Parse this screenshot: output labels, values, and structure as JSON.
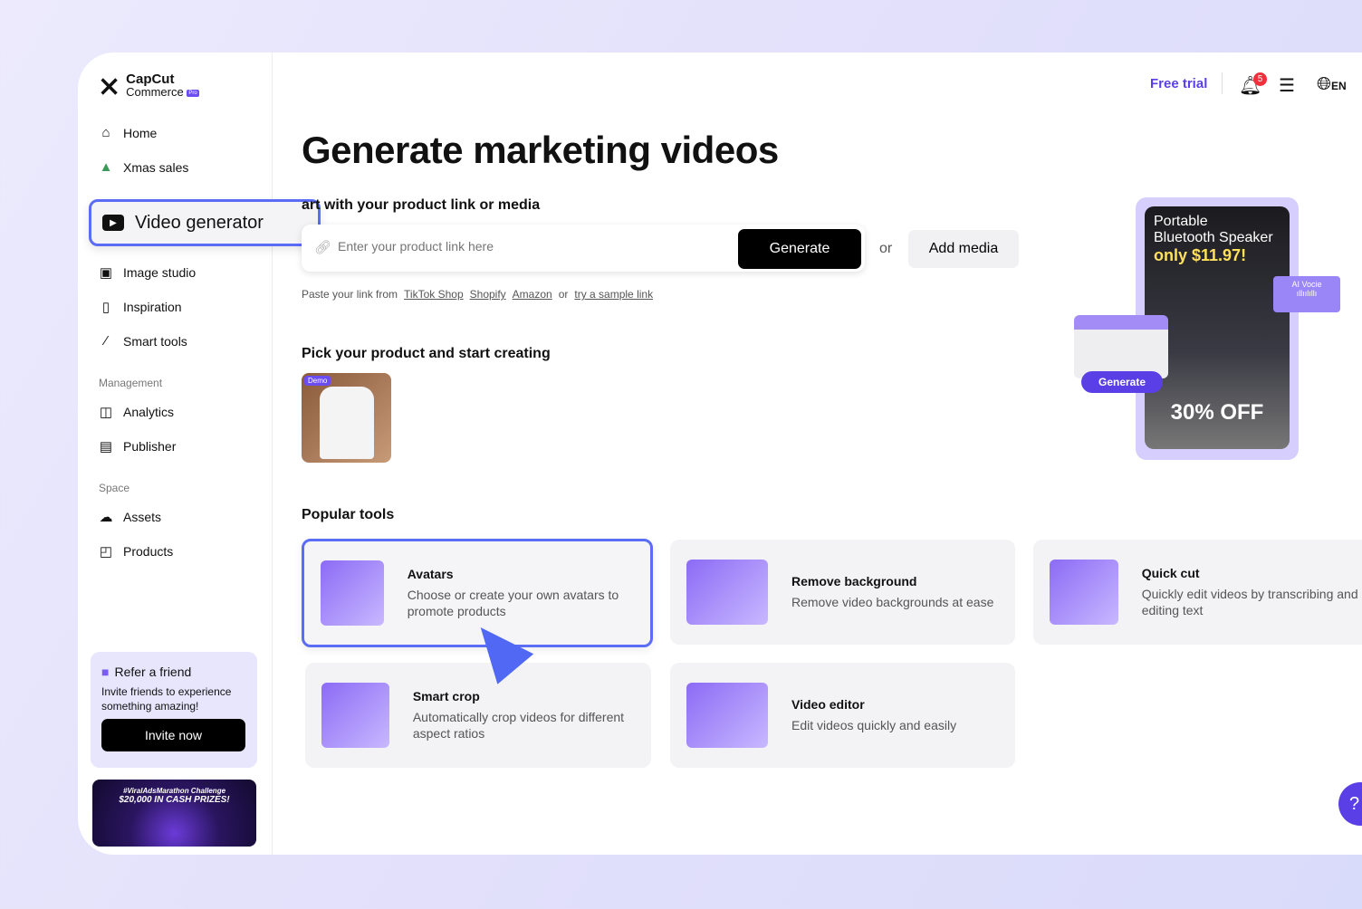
{
  "brand": {
    "name": "CapCut",
    "sub": "Commerce",
    "badge": "Pro"
  },
  "sidebar": {
    "items": [
      {
        "label": "Home",
        "icon": "home-icon"
      },
      {
        "label": "Xmas sales",
        "icon": "tree-icon"
      },
      {
        "label": "Video generator",
        "icon": "video-sparkle-icon"
      },
      {
        "label": "Image studio",
        "icon": "image-icon"
      },
      {
        "label": "Inspiration",
        "icon": "inspiration-icon"
      },
      {
        "label": "Smart tools",
        "icon": "magic-wand-icon"
      }
    ],
    "management_label": "Management",
    "management": [
      {
        "label": "Analytics",
        "icon": "chart-icon"
      },
      {
        "label": "Publisher",
        "icon": "calendar-icon"
      }
    ],
    "space_label": "Space",
    "space": [
      {
        "label": "Assets",
        "icon": "cloud-icon"
      },
      {
        "label": "Products",
        "icon": "bag-icon"
      }
    ],
    "refer": {
      "title": "Refer a friend",
      "text": "Invite friends to experience something amazing!",
      "button": "Invite now"
    },
    "banner": {
      "line1": "#ViralAdsMarathon Challenge",
      "line2": "$20,000 IN CASH PRIZES!"
    }
  },
  "header": {
    "free_trial": "Free trial",
    "notifications": "5",
    "language": "EN"
  },
  "main": {
    "title": "Generate marketing videos",
    "start_label": "art with your product link or media",
    "input_placeholder": "Enter your product link here",
    "generate": "Generate",
    "or": "or",
    "add_media": "Add media",
    "paste": {
      "prefix": "Paste your link from",
      "tiktok": "TikTok Shop",
      "shopify": "Shopify",
      "amazon": "Amazon",
      "or": "or",
      "sample": "try a sample link"
    },
    "pick_label": "Pick your product and start creating",
    "demo_badge": "Demo",
    "popular_label": "Popular tools",
    "tools": [
      {
        "title": "Avatars",
        "desc": "Choose or create your own avatars to promote products"
      },
      {
        "title": "Remove background",
        "desc": "Remove video backgrounds at ease"
      },
      {
        "title": "Quick cut",
        "desc": "Quickly edit videos by transcribing and editing text"
      },
      {
        "title": "Smart crop",
        "desc": "Automatically crop videos for different aspect ratios"
      },
      {
        "title": "Video editor",
        "desc": "Edit videos quickly and easily"
      }
    ],
    "promo": {
      "line1": "Portable",
      "line2": "Bluetooth Speaker",
      "price": "only $11.97!",
      "discount": "30% OFF",
      "ai_voice": "AI Vocie",
      "generate": "Generate"
    }
  },
  "colors": {
    "accent": "#5b3fe6",
    "highlight": "#5b6cf5",
    "badge": "#f0303c"
  }
}
